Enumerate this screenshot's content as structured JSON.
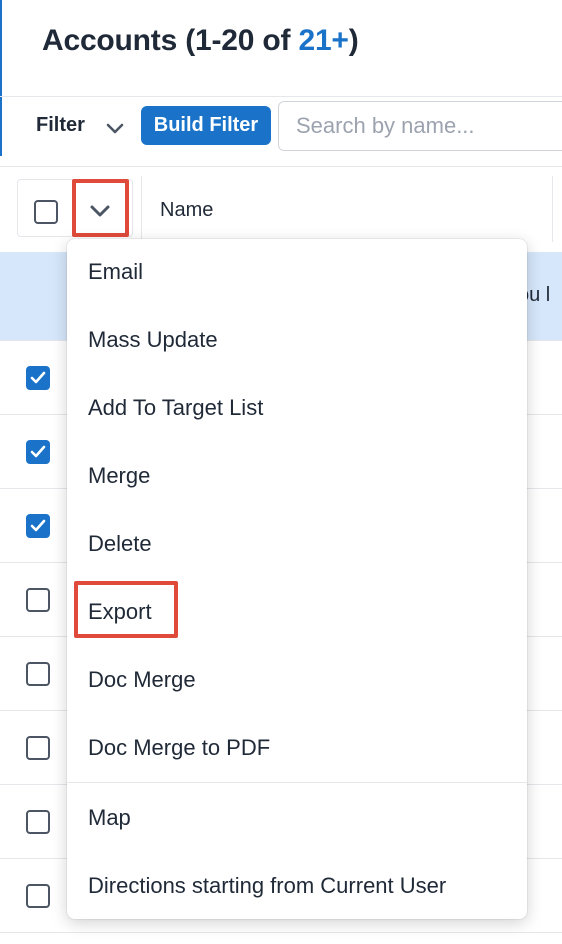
{
  "header": {
    "title_prefix": "Accounts (1-20 of ",
    "title_count": "21+",
    "title_suffix": ")"
  },
  "toolbar": {
    "filter_label": "Filter",
    "build_filter_label": "Build Filter",
    "search_placeholder": "Search by name..."
  },
  "table": {
    "columns": [
      "Name"
    ],
    "info_text": "ou l",
    "rows": [
      {
        "checked": true
      },
      {
        "checked": true
      },
      {
        "checked": true
      },
      {
        "checked": false
      },
      {
        "checked": false
      },
      {
        "checked": false
      },
      {
        "checked": false
      },
      {
        "checked": false
      }
    ]
  },
  "mass_actions_menu": {
    "items": [
      "Email",
      "Mass Update",
      "Add To Target List",
      "Merge",
      "Delete",
      "Export",
      "Doc Merge",
      "Doc Merge to PDF"
    ],
    "secondary_items": [
      "Map",
      "Directions starting from Current User"
    ]
  },
  "colors": {
    "accent": "#1a73c9",
    "callout": "#e04a3a",
    "info_row_bg": "#d6e7fb"
  }
}
